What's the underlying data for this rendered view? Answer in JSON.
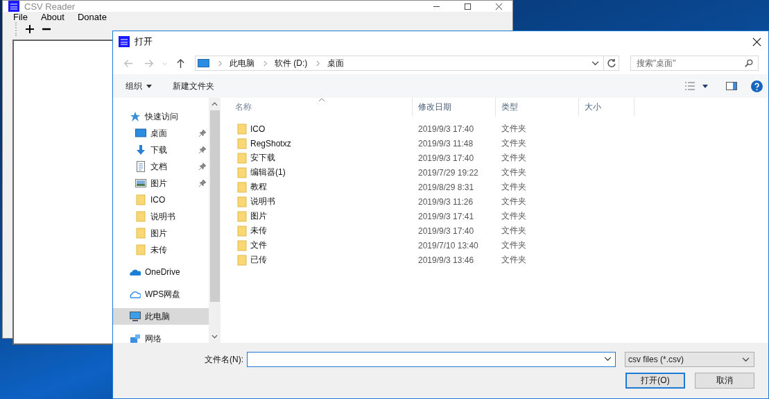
{
  "app_window": {
    "title": "CSV Reader",
    "menu": [
      "File",
      "About",
      "Donate"
    ]
  },
  "dialog": {
    "title": "打开",
    "breadcrumb": [
      "此电脑",
      "软件 (D:)",
      "桌面"
    ],
    "search": {
      "placeholder": "搜索\"桌面\""
    },
    "toolbar": [
      {
        "label": "组织",
        "dropdown": true
      },
      {
        "label": "新建文件夹",
        "dropdown": false
      }
    ],
    "nav": [
      {
        "label": "快速访问",
        "kind": "star",
        "selected": false,
        "children": [
          {
            "label": "桌面",
            "kind": "desktop",
            "pinned": true,
            "selected": false
          },
          {
            "label": "下载",
            "kind": "download",
            "pinned": true,
            "selected": false
          },
          {
            "label": "文档",
            "kind": "document",
            "pinned": true,
            "selected": false
          },
          {
            "label": "图片",
            "kind": "pictures",
            "pinned": true,
            "selected": false
          },
          {
            "label": "ICO",
            "kind": "folder",
            "pinned": false,
            "selected": false
          },
          {
            "label": "说明书",
            "kind": "folder",
            "pinned": false,
            "selected": false
          },
          {
            "label": "图片",
            "kind": "folder",
            "pinned": false,
            "selected": false
          },
          {
            "label": "未传",
            "kind": "folder",
            "pinned": false,
            "selected": false
          }
        ]
      },
      {
        "label": "OneDrive",
        "kind": "cloud",
        "selected": false
      },
      {
        "label": "WPS网盘",
        "kind": "cloud-outline",
        "selected": false
      },
      {
        "label": "此电脑",
        "kind": "computer",
        "selected": true
      },
      {
        "label": "网络",
        "kind": "network",
        "selected": false
      }
    ],
    "columns": [
      "名称",
      "修改日期",
      "类型",
      "大小"
    ],
    "rows": [
      {
        "name": "ICO",
        "modified": "2019/9/3 17:40",
        "type": "文件夹"
      },
      {
        "name": "RegShotxz",
        "modified": "2019/9/3 11:48",
        "type": "文件夹"
      },
      {
        "name": "安下载",
        "modified": "2019/9/3 17:40",
        "type": "文件夹"
      },
      {
        "name": "编辑器(1)",
        "modified": "2019/7/29 19:22",
        "type": "文件夹"
      },
      {
        "name": "教程",
        "modified": "2019/8/29 8:31",
        "type": "文件夹"
      },
      {
        "name": "说明书",
        "modified": "2019/9/3 11:26",
        "type": "文件夹"
      },
      {
        "name": "图片",
        "modified": "2019/9/3 17:41",
        "type": "文件夹"
      },
      {
        "name": "未传",
        "modified": "2019/9/3 17:40",
        "type": "文件夹"
      },
      {
        "name": "文件",
        "modified": "2019/7/10 13:40",
        "type": "文件夹"
      },
      {
        "name": "已传",
        "modified": "2019/9/3 13:46",
        "type": "文件夹"
      }
    ],
    "filename_label": "文件名(N):",
    "filter": "csv files (*.csv)",
    "buttons": [
      {
        "label": "打开(O)",
        "default": true
      },
      {
        "label": "取消",
        "default": false
      }
    ]
  }
}
